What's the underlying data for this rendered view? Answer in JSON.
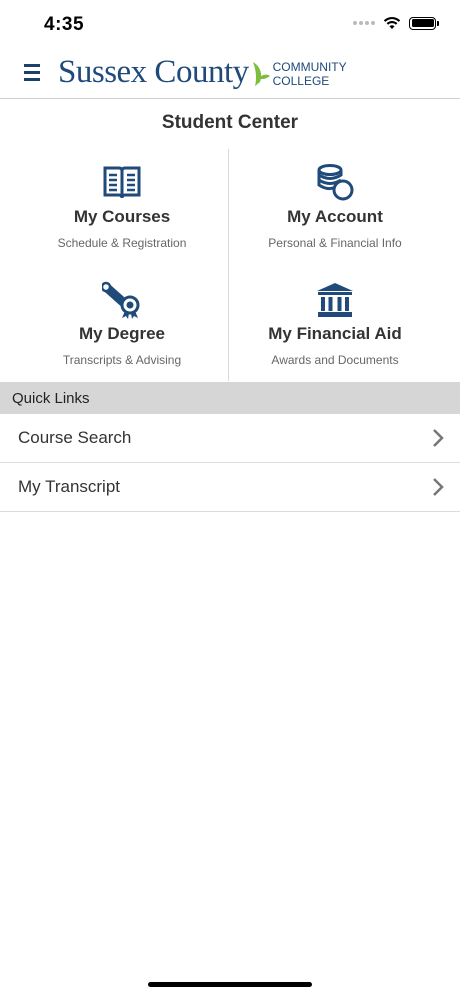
{
  "status_bar": {
    "time": "4:35"
  },
  "header": {
    "logo_main": "Sussex County",
    "logo_sub_line1": "COMMUNITY",
    "logo_sub_line2": "COLLEGE",
    "brand_color": "#1f4a7a",
    "leaf_color": "#7bbf3c"
  },
  "student_center": {
    "title": "Student Center",
    "tiles": [
      {
        "title": "My Courses",
        "subtitle": "Schedule & Registration",
        "icon": "book-icon"
      },
      {
        "title": "My Account",
        "subtitle": "Personal & Financial Info",
        "icon": "coins-icon"
      },
      {
        "title": "My Degree",
        "subtitle": "Transcripts & Advising",
        "icon": "diploma-icon"
      },
      {
        "title": "My Financial Aid",
        "subtitle": "Awards and Documents",
        "icon": "bank-icon"
      }
    ]
  },
  "quick_links": {
    "title": "Quick Links",
    "items": [
      {
        "label": "Course Search"
      },
      {
        "label": "My Transcript"
      }
    ]
  }
}
